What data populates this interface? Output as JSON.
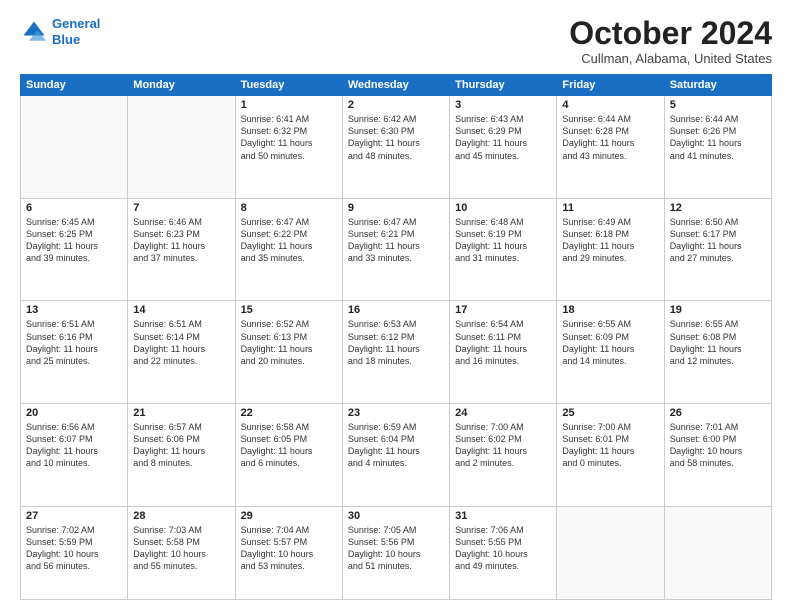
{
  "header": {
    "logo_line1": "General",
    "logo_line2": "Blue",
    "month": "October 2024",
    "location": "Cullman, Alabama, United States"
  },
  "weekdays": [
    "Sunday",
    "Monday",
    "Tuesday",
    "Wednesday",
    "Thursday",
    "Friday",
    "Saturday"
  ],
  "weeks": [
    [
      {
        "day": "",
        "content": ""
      },
      {
        "day": "",
        "content": ""
      },
      {
        "day": "1",
        "content": "Sunrise: 6:41 AM\nSunset: 6:32 PM\nDaylight: 11 hours\nand 50 minutes."
      },
      {
        "day": "2",
        "content": "Sunrise: 6:42 AM\nSunset: 6:30 PM\nDaylight: 11 hours\nand 48 minutes."
      },
      {
        "day": "3",
        "content": "Sunrise: 6:43 AM\nSunset: 6:29 PM\nDaylight: 11 hours\nand 45 minutes."
      },
      {
        "day": "4",
        "content": "Sunrise: 6:44 AM\nSunset: 6:28 PM\nDaylight: 11 hours\nand 43 minutes."
      },
      {
        "day": "5",
        "content": "Sunrise: 6:44 AM\nSunset: 6:26 PM\nDaylight: 11 hours\nand 41 minutes."
      }
    ],
    [
      {
        "day": "6",
        "content": "Sunrise: 6:45 AM\nSunset: 6:25 PM\nDaylight: 11 hours\nand 39 minutes."
      },
      {
        "day": "7",
        "content": "Sunrise: 6:46 AM\nSunset: 6:23 PM\nDaylight: 11 hours\nand 37 minutes."
      },
      {
        "day": "8",
        "content": "Sunrise: 6:47 AM\nSunset: 6:22 PM\nDaylight: 11 hours\nand 35 minutes."
      },
      {
        "day": "9",
        "content": "Sunrise: 6:47 AM\nSunset: 6:21 PM\nDaylight: 11 hours\nand 33 minutes."
      },
      {
        "day": "10",
        "content": "Sunrise: 6:48 AM\nSunset: 6:19 PM\nDaylight: 11 hours\nand 31 minutes."
      },
      {
        "day": "11",
        "content": "Sunrise: 6:49 AM\nSunset: 6:18 PM\nDaylight: 11 hours\nand 29 minutes."
      },
      {
        "day": "12",
        "content": "Sunrise: 6:50 AM\nSunset: 6:17 PM\nDaylight: 11 hours\nand 27 minutes."
      }
    ],
    [
      {
        "day": "13",
        "content": "Sunrise: 6:51 AM\nSunset: 6:16 PM\nDaylight: 11 hours\nand 25 minutes."
      },
      {
        "day": "14",
        "content": "Sunrise: 6:51 AM\nSunset: 6:14 PM\nDaylight: 11 hours\nand 22 minutes."
      },
      {
        "day": "15",
        "content": "Sunrise: 6:52 AM\nSunset: 6:13 PM\nDaylight: 11 hours\nand 20 minutes."
      },
      {
        "day": "16",
        "content": "Sunrise: 6:53 AM\nSunset: 6:12 PM\nDaylight: 11 hours\nand 18 minutes."
      },
      {
        "day": "17",
        "content": "Sunrise: 6:54 AM\nSunset: 6:11 PM\nDaylight: 11 hours\nand 16 minutes."
      },
      {
        "day": "18",
        "content": "Sunrise: 6:55 AM\nSunset: 6:09 PM\nDaylight: 11 hours\nand 14 minutes."
      },
      {
        "day": "19",
        "content": "Sunrise: 6:55 AM\nSunset: 6:08 PM\nDaylight: 11 hours\nand 12 minutes."
      }
    ],
    [
      {
        "day": "20",
        "content": "Sunrise: 6:56 AM\nSunset: 6:07 PM\nDaylight: 11 hours\nand 10 minutes."
      },
      {
        "day": "21",
        "content": "Sunrise: 6:57 AM\nSunset: 6:06 PM\nDaylight: 11 hours\nand 8 minutes."
      },
      {
        "day": "22",
        "content": "Sunrise: 6:58 AM\nSunset: 6:05 PM\nDaylight: 11 hours\nand 6 minutes."
      },
      {
        "day": "23",
        "content": "Sunrise: 6:59 AM\nSunset: 6:04 PM\nDaylight: 11 hours\nand 4 minutes."
      },
      {
        "day": "24",
        "content": "Sunrise: 7:00 AM\nSunset: 6:02 PM\nDaylight: 11 hours\nand 2 minutes."
      },
      {
        "day": "25",
        "content": "Sunrise: 7:00 AM\nSunset: 6:01 PM\nDaylight: 11 hours\nand 0 minutes."
      },
      {
        "day": "26",
        "content": "Sunrise: 7:01 AM\nSunset: 6:00 PM\nDaylight: 10 hours\nand 58 minutes."
      }
    ],
    [
      {
        "day": "27",
        "content": "Sunrise: 7:02 AM\nSunset: 5:59 PM\nDaylight: 10 hours\nand 56 minutes."
      },
      {
        "day": "28",
        "content": "Sunrise: 7:03 AM\nSunset: 5:58 PM\nDaylight: 10 hours\nand 55 minutes."
      },
      {
        "day": "29",
        "content": "Sunrise: 7:04 AM\nSunset: 5:57 PM\nDaylight: 10 hours\nand 53 minutes."
      },
      {
        "day": "30",
        "content": "Sunrise: 7:05 AM\nSunset: 5:56 PM\nDaylight: 10 hours\nand 51 minutes."
      },
      {
        "day": "31",
        "content": "Sunrise: 7:06 AM\nSunset: 5:55 PM\nDaylight: 10 hours\nand 49 minutes."
      },
      {
        "day": "",
        "content": ""
      },
      {
        "day": "",
        "content": ""
      }
    ]
  ]
}
